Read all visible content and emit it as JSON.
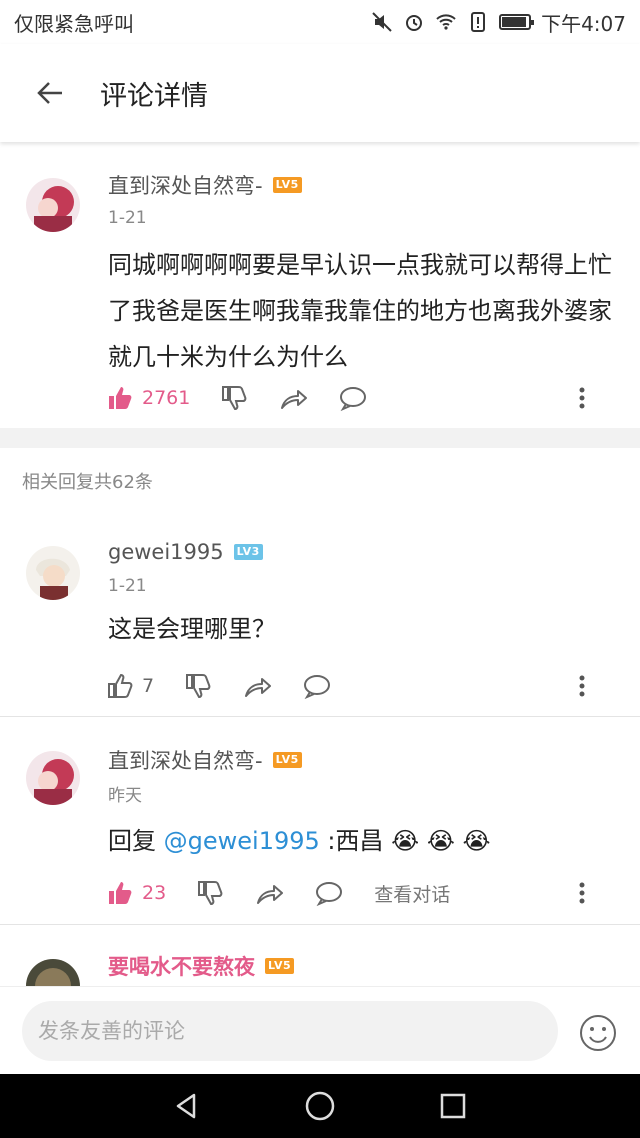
{
  "status_bar": {
    "carrier": "仅限紧急呼叫",
    "time": "下午4:07",
    "battery_level": 0.85
  },
  "header": {
    "title": "评论详情"
  },
  "main_comment": {
    "username": "直到深处自然弯-",
    "level": "LV5",
    "date": "1-21",
    "text": "同城啊啊啊啊要是早认识一点我就可以帮得上忙了我爸是医生啊我靠我靠住的地方也离我外婆家就几十米为什么为什么",
    "likes": "2761"
  },
  "related_header": "相关回复共62条",
  "replies": [
    {
      "username": "gewei1995",
      "level": "LV3",
      "date": "1-21",
      "text": "这是会理哪里？",
      "likes": "7"
    },
    {
      "username": "直到深处自然弯-",
      "level": "LV5",
      "date": "昨天",
      "reply_prefix": "回复 ",
      "reply_mention": "@gewei1995",
      "reply_text": " :西昌",
      "emoji": [
        "😭",
        "😭",
        "😭"
      ],
      "likes": "23",
      "view_conversation": "查看对话"
    },
    {
      "username": "要喝水不要熬夜",
      "level": "LV5"
    }
  ],
  "input": {
    "placeholder": "发条友善的评论"
  },
  "colors": {
    "accent_pink": "#e35b8a",
    "link_blue": "#2d8fd5",
    "level_orange": "#f59a23",
    "level_blue": "#6cc3e8"
  }
}
